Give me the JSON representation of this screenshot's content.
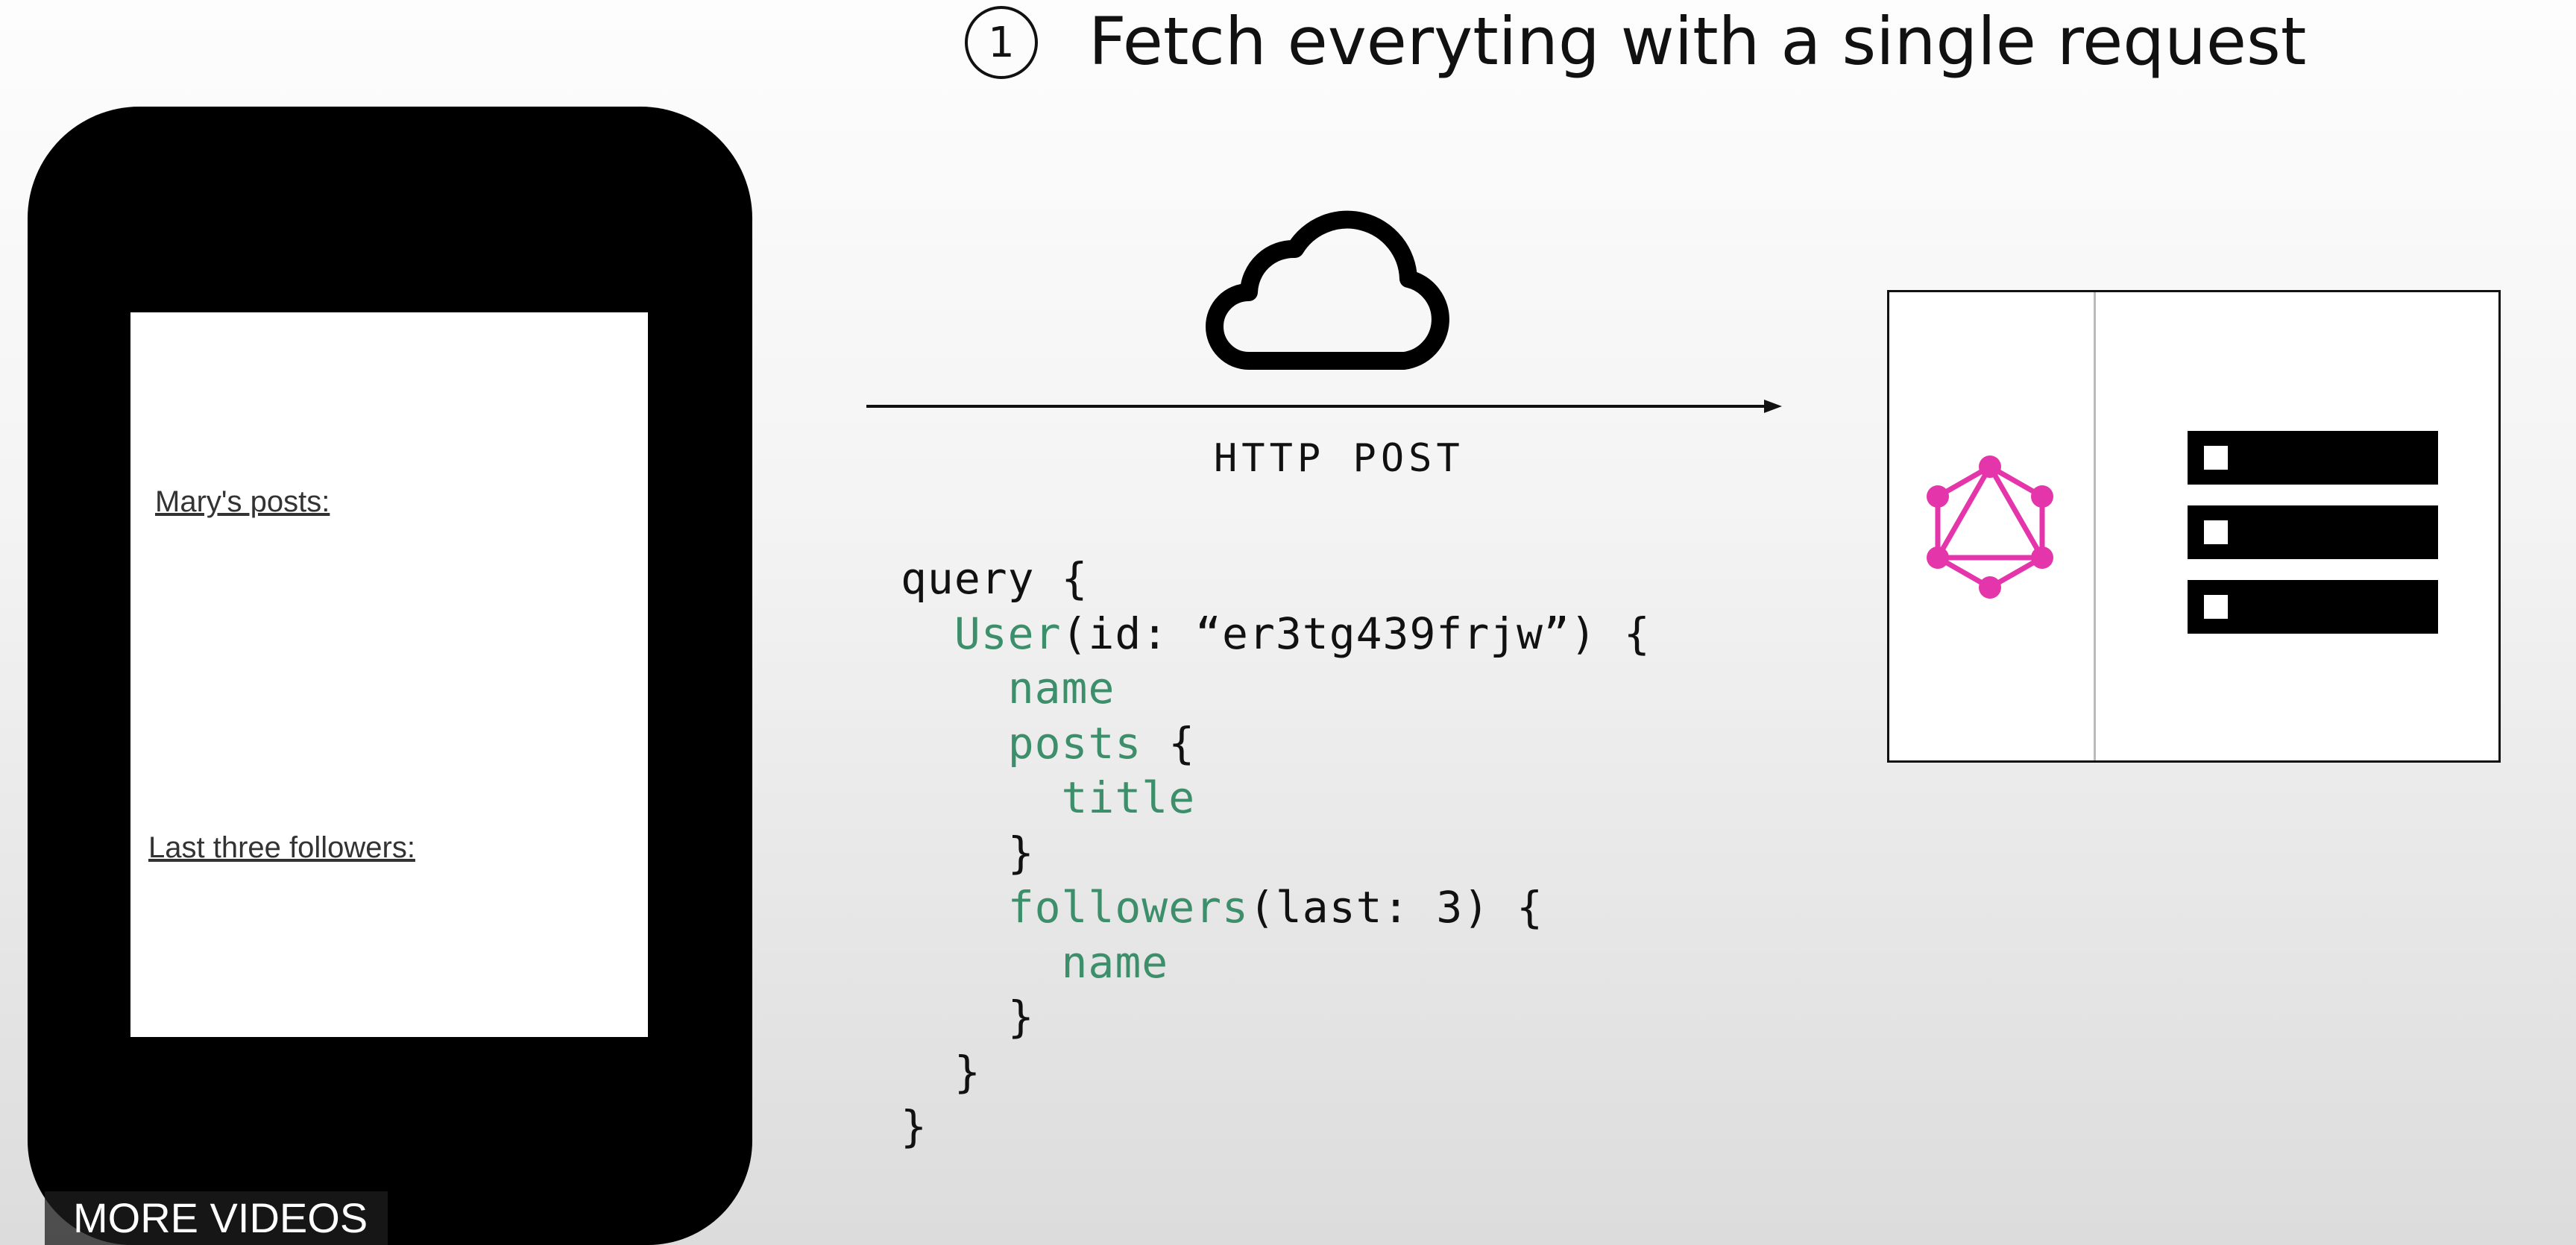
{
  "slide": {
    "step_number": "1",
    "title": "Fetch everyting with a single request"
  },
  "phone": {
    "posts_label": "Mary's posts:",
    "followers_label": "Last three followers:"
  },
  "network": {
    "method_label": "HTTP POST"
  },
  "query": {
    "lines": [
      {
        "pre": "",
        "kw": "",
        "post": "query {"
      },
      {
        "pre": "  ",
        "kw": "User",
        "post": "(id: “er3tg439frjw”) {"
      },
      {
        "pre": "    ",
        "kw": "name",
        "post": ""
      },
      {
        "pre": "    ",
        "kw": "posts",
        "post": " {"
      },
      {
        "pre": "      ",
        "kw": "title",
        "post": ""
      },
      {
        "pre": "    ",
        "kw": "",
        "post": "}"
      },
      {
        "pre": "    ",
        "kw": "followers",
        "post": "(last: 3) {"
      },
      {
        "pre": "      ",
        "kw": "name",
        "post": ""
      },
      {
        "pre": "    ",
        "kw": "",
        "post": "}"
      },
      {
        "pre": "  ",
        "kw": "",
        "post": "}"
      },
      {
        "pre": "",
        "kw": "",
        "post": "}"
      }
    ]
  },
  "player": {
    "more_videos_label": "MORE VIDEOS"
  },
  "icons": {
    "cloud": "cloud-icon",
    "graphql": "graphql-logo-icon",
    "database": "database-server-icon"
  },
  "colors": {
    "keyword": "#3d8f6b",
    "graphql_pink": "#e535ab"
  }
}
